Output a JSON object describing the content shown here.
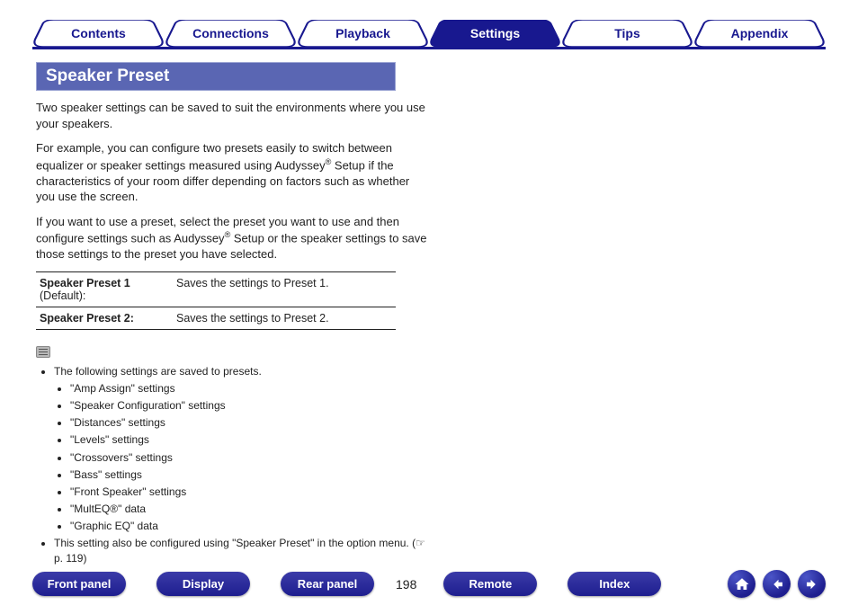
{
  "tabs": [
    {
      "label": "Contents",
      "active": false
    },
    {
      "label": "Connections",
      "active": false
    },
    {
      "label": "Playback",
      "active": false
    },
    {
      "label": "Settings",
      "active": true
    },
    {
      "label": "Tips",
      "active": false
    },
    {
      "label": "Appendix",
      "active": false
    }
  ],
  "section_title": "Speaker Preset",
  "para1": "Two speaker settings can be saved to suit the environments where you use your speakers.",
  "para2a": "For example, you can configure two presets easily to switch between equalizer or speaker settings measured using Audyssey",
  "para2b": " Setup if the characteristics of your room differ depending on factors such as whether you use the screen.",
  "para3a": "If you want to use a preset, select the preset you want to use and then configure settings such as Audyssey",
  "para3b": " Setup or the speaker settings to save those settings to the preset you have selected.",
  "presets": [
    {
      "name": "Speaker Preset 1",
      "extra": "(Default):",
      "desc": "Saves the settings to Preset 1."
    },
    {
      "name": "Speaker Preset 2:",
      "extra": "",
      "desc": "Saves the settings to Preset 2."
    }
  ],
  "notes_intro": "The following settings are saved to presets.",
  "saved_settings": [
    "\"Amp Assign\" settings",
    "\"Speaker Configuration\" settings",
    "\"Distances\" settings",
    "\"Levels\" settings",
    "\"Crossovers\" settings",
    "\"Bass\" settings",
    "\"Front Speaker\" settings",
    "\"MultEQ®\" data",
    "\"Graphic EQ\" data"
  ],
  "note2a": "This setting also be configured using \"Speaker Preset\" in the option menu. (",
  "note2_ref": " p. 119)",
  "footer": {
    "front": "Front panel",
    "display": "Display",
    "rear": "Rear panel",
    "remote": "Remote",
    "index": "Index",
    "page": "198"
  }
}
